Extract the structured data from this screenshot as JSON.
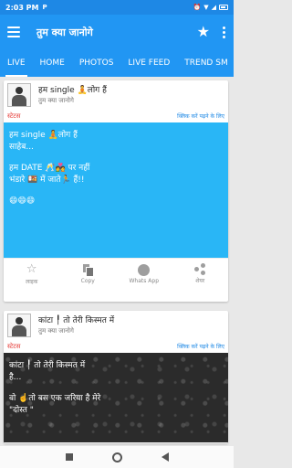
{
  "status_bar": {
    "time": "2:03 PM",
    "indicator": "P",
    "battery_icon": "battery-icon"
  },
  "app_bar": {
    "title": "तुम क्या जानोगे",
    "star_icon": "★"
  },
  "tabs": [
    {
      "label": "LIVE",
      "active": true
    },
    {
      "label": "HOME"
    },
    {
      "label": "PHOTOS"
    },
    {
      "label": "LIVE FEED"
    },
    {
      "label": "TREND SM"
    }
  ],
  "posts": [
    {
      "title": "हम single 🧘लोग हैं",
      "subtitle": "तुम क्या जानोगे",
      "category": "स्टेटस",
      "read_more": "क्लिक करें पढ़ने के लिए",
      "content": [
        "हम single 🧘लोग हैं",
        "साहेब...",
        "",
        "हम DATE 🥂💑 पर नहीं",
        "भंडारे 🍱 में जाते🏃 हैं!!",
        "",
        "😄😄😄"
      ],
      "actions": {
        "like": "लाइक",
        "copy": "Copy",
        "whatsapp": "Whats App",
        "share": "शेयर"
      }
    },
    {
      "title": "कांटा ╿ तो तेरी किस्मत में",
      "subtitle": "तुम क्या जानोगे",
      "category": "स्टेटस",
      "read_more": "क्लिक करें पढ़ने के लिए",
      "content": [
        "कांटा ╿ तो तेरी किस्मत में",
        "है...",
        "",
        "वो ☝️तो बस एक जरिया है मेरे",
        "\"दोस्त \""
      ]
    }
  ]
}
